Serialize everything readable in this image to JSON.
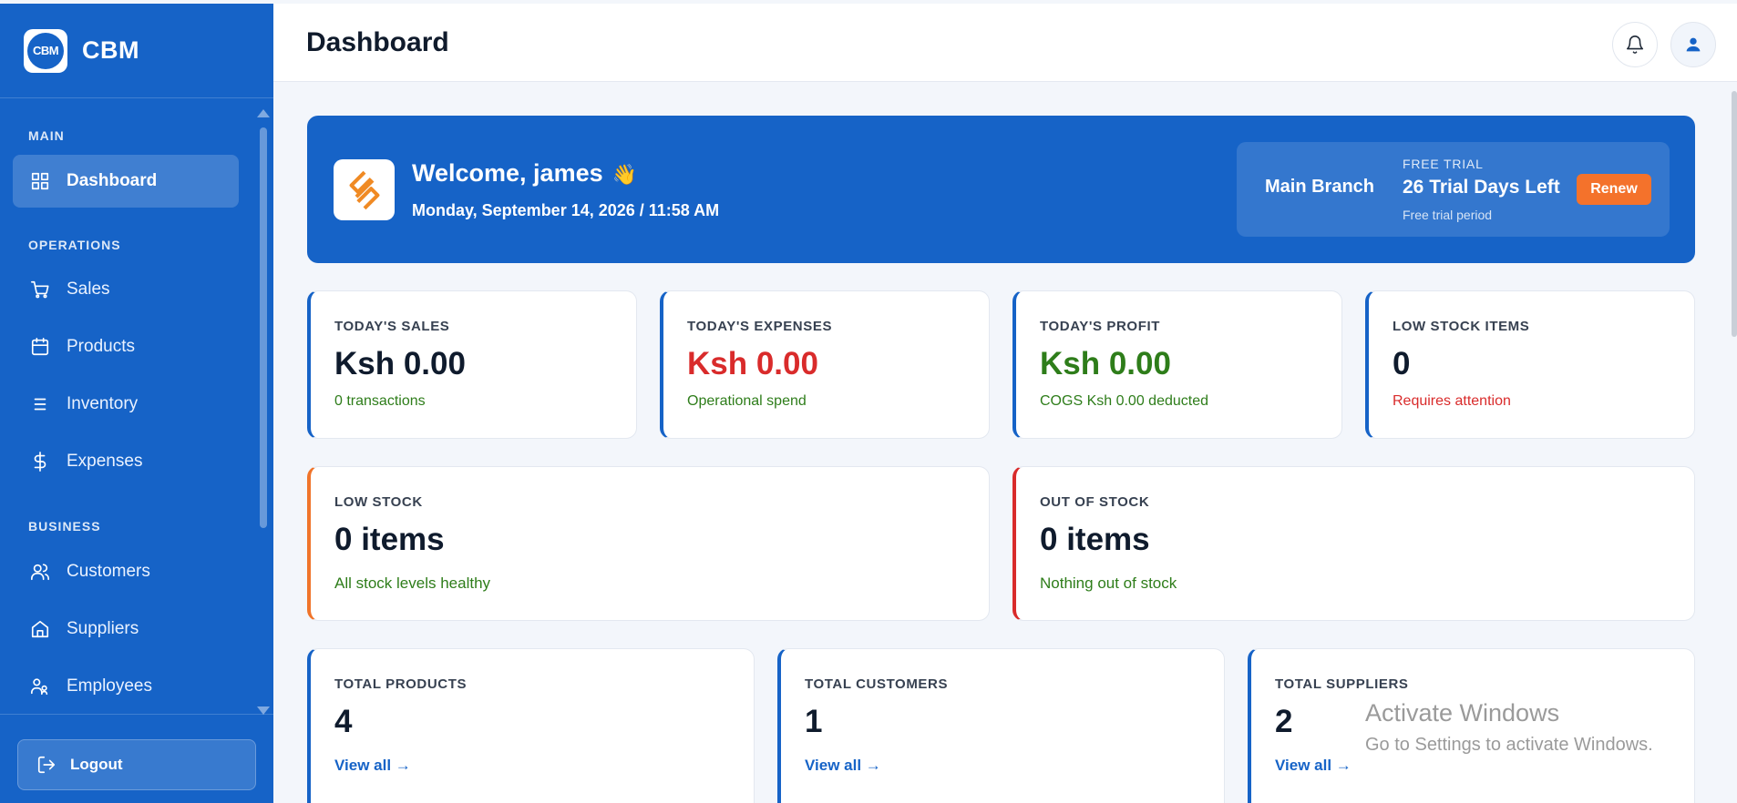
{
  "brand": {
    "logo_text": "CBM",
    "name": "CBM"
  },
  "sidebar": {
    "sections": [
      {
        "title": "MAIN"
      },
      {
        "title": "OPERATIONS"
      },
      {
        "title": "BUSINESS"
      }
    ],
    "items": [
      {
        "label": "Dashboard",
        "icon": "grid-icon",
        "active": true
      },
      {
        "label": "Sales",
        "icon": "cart-icon"
      },
      {
        "label": "Products",
        "icon": "calendar-icon"
      },
      {
        "label": "Inventory",
        "icon": "list-icon"
      },
      {
        "label": "Expenses",
        "icon": "dollar-icon"
      },
      {
        "label": "Customers",
        "icon": "users-icon"
      },
      {
        "label": "Suppliers",
        "icon": "house-icon"
      },
      {
        "label": "Employees",
        "icon": "employees-icon"
      }
    ],
    "logout_label": "Logout"
  },
  "header": {
    "title": "Dashboard"
  },
  "welcome": {
    "greeting": "Welcome, james",
    "wave": "👋",
    "datetime": "Monday, September 14, 2026 / 11:58 AM",
    "branch": "Main Branch",
    "trial_tag": "FREE TRIAL",
    "trial_days": "26 Trial Days Left",
    "trial_sub": "Free trial period",
    "renew_label": "Renew"
  },
  "stats": [
    {
      "label": "TODAY'S SALES",
      "value": "Ksh 0.00",
      "sub": "0 transactions"
    },
    {
      "label": "TODAY'S EXPENSES",
      "value": "Ksh 0.00",
      "sub": "Operational spend"
    },
    {
      "label": "TODAY'S PROFIT",
      "value": "Ksh 0.00",
      "sub": "COGS Ksh 0.00 deducted"
    },
    {
      "label": "LOW STOCK ITEMS",
      "value": "0",
      "sub": "Requires attention"
    }
  ],
  "stock": [
    {
      "label": "LOW STOCK",
      "value": "0 items",
      "sub": "All stock levels healthy"
    },
    {
      "label": "OUT OF STOCK",
      "value": "0 items",
      "sub": "Nothing out of stock"
    }
  ],
  "totals": [
    {
      "label": "TOTAL PRODUCTS",
      "value": "4",
      "link": "View all →"
    },
    {
      "label": "TOTAL CUSTOMERS",
      "value": "1",
      "link": "View all →"
    },
    {
      "label": "TOTAL SUPPLIERS",
      "value": "2",
      "link": "View all →"
    }
  ],
  "watermark": {
    "line1": "Activate Windows",
    "line2": "Go to Settings to activate Windows."
  },
  "colors": {
    "primary": "#1663c7",
    "danger": "#d92b2b",
    "success": "#2e7d1a",
    "warning": "#f0742a",
    "renew": "#f4722b"
  }
}
